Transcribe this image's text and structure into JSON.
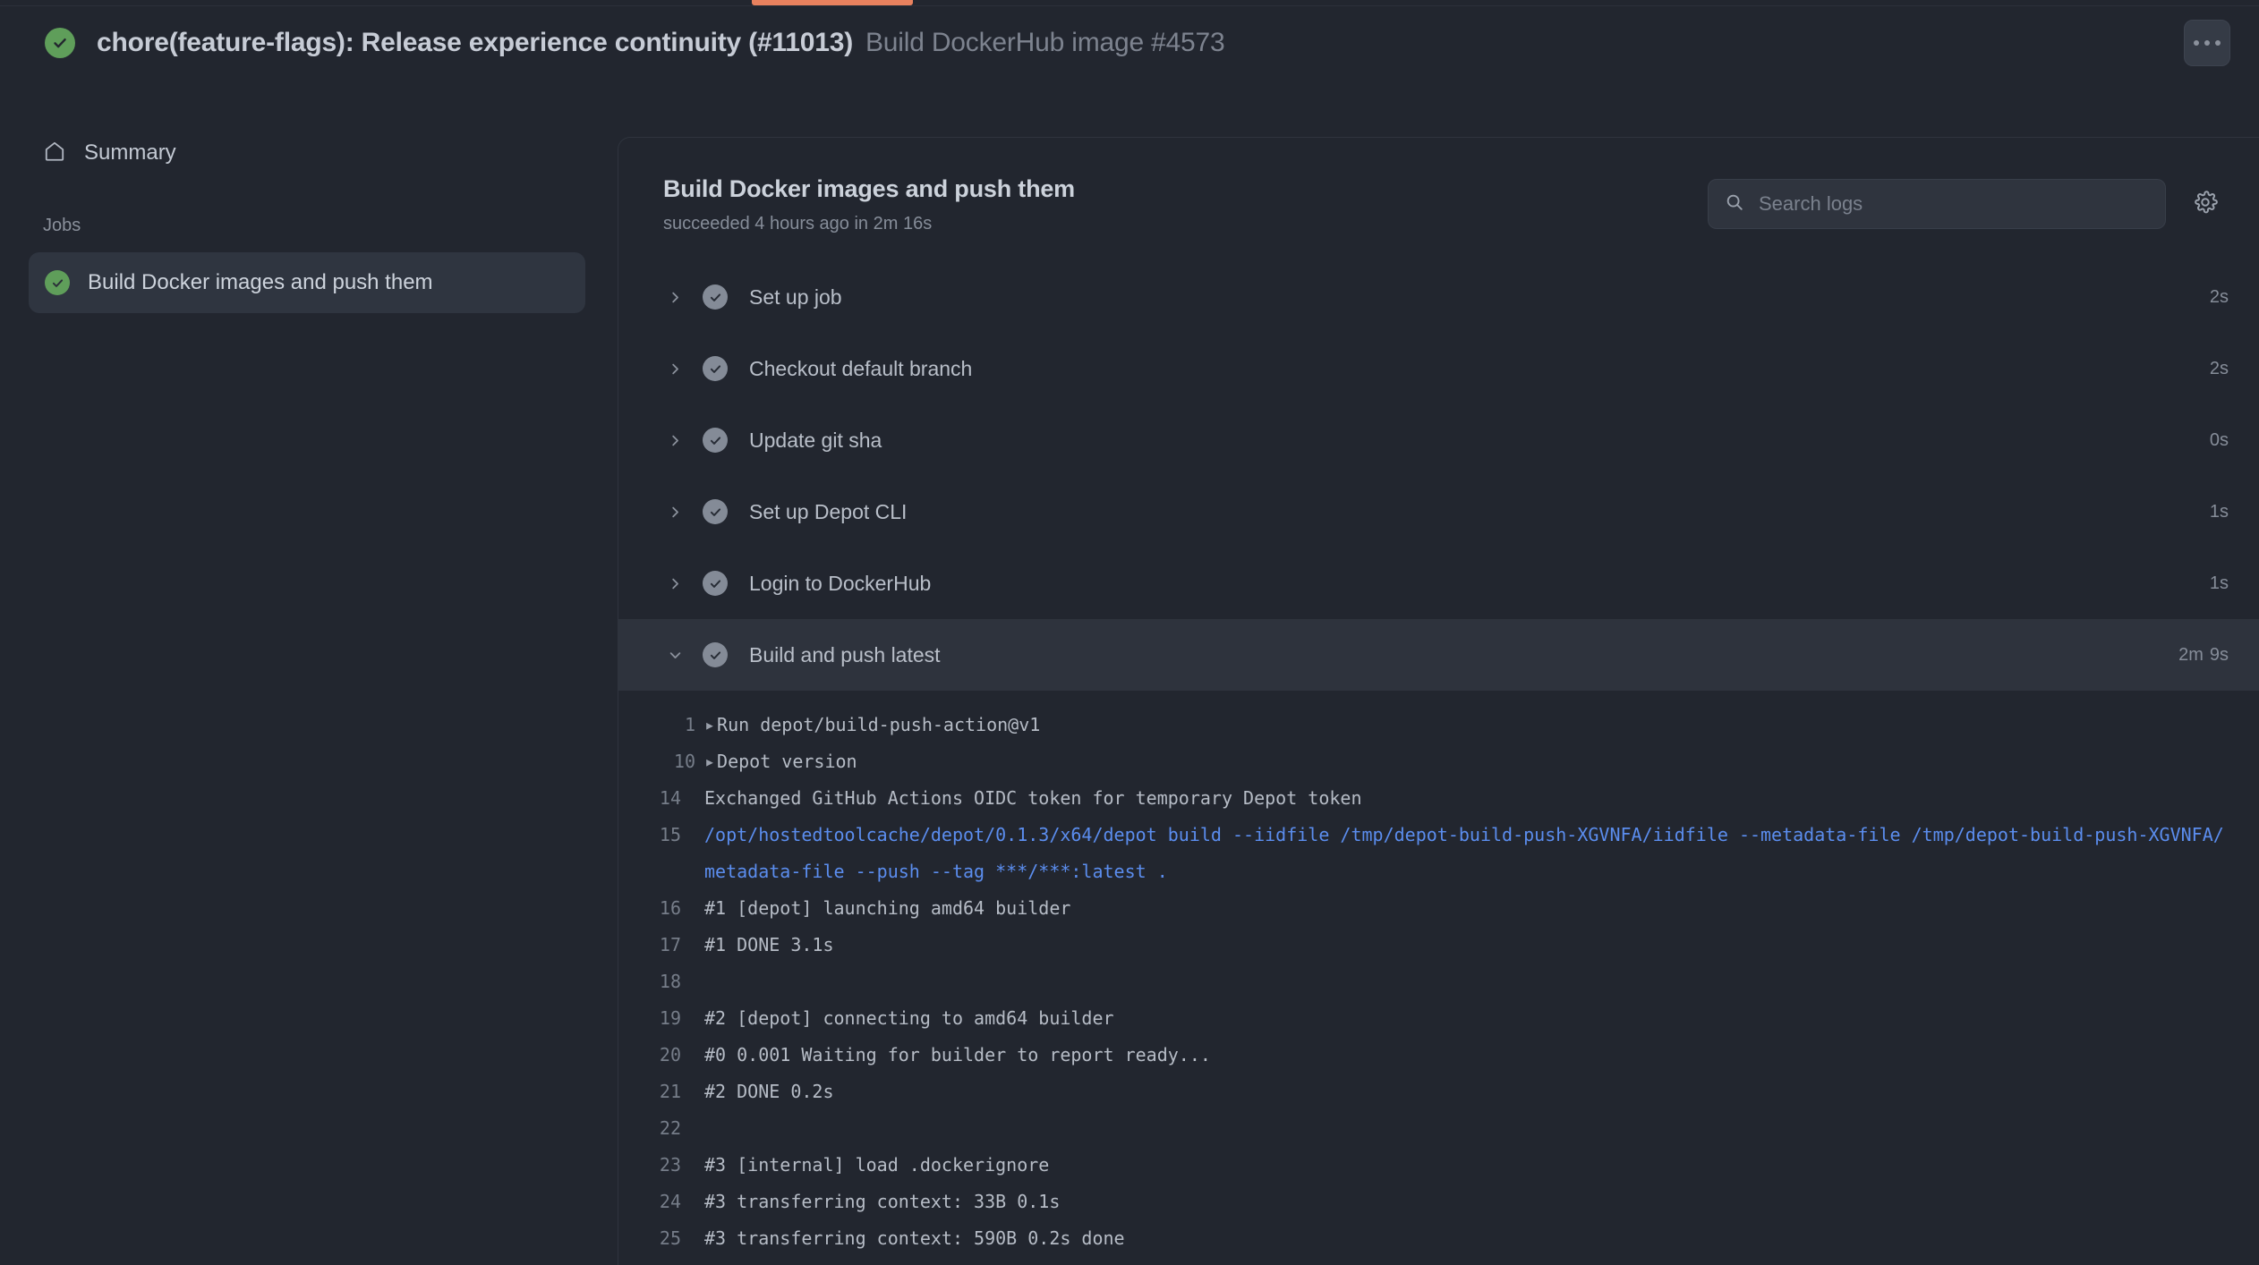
{
  "header": {
    "status_icon": "check-circle-icon",
    "run_title": "chore(feature-flags): Release experience continuity (#11013)",
    "workflow_subtitle": "Build DockerHub image #4573",
    "kebab_label": "More options",
    "accent_color": "#e8815e",
    "success_color": "#5f9e5a"
  },
  "sidebar": {
    "summary": {
      "icon": "home-icon",
      "label": "Summary"
    },
    "section_title": "Jobs",
    "jobs": [
      {
        "label": "Build Docker images and push them",
        "status": "success",
        "selected": true
      }
    ]
  },
  "panel": {
    "title": "Build Docker images and push them",
    "meta": "succeeded 4 hours ago in 2m 16s",
    "search": {
      "placeholder": "Search logs",
      "value": "",
      "icon": "search-icon"
    },
    "settings_icon": "gear-icon"
  },
  "steps": [
    {
      "name": "Set up job",
      "status": "success",
      "expanded": false,
      "duration": "2s",
      "duration_minutes": ""
    },
    {
      "name": "Checkout default branch",
      "status": "success",
      "expanded": false,
      "duration": "2s",
      "duration_minutes": ""
    },
    {
      "name": "Update git sha",
      "status": "success",
      "expanded": false,
      "duration": "0s",
      "duration_minutes": ""
    },
    {
      "name": "Set up Depot CLI",
      "status": "success",
      "expanded": false,
      "duration": "1s",
      "duration_minutes": ""
    },
    {
      "name": "Login to DockerHub",
      "status": "success",
      "expanded": false,
      "duration": "1s",
      "duration_minutes": ""
    },
    {
      "name": "Build and push latest",
      "status": "success",
      "expanded": true,
      "duration": "9s",
      "duration_minutes": "2m"
    }
  ],
  "log": {
    "lines": [
      {
        "num": "1",
        "text": "Run depot/build-push-action@v1",
        "collapsible": true,
        "kind": "plain"
      },
      {
        "num": "10",
        "text": "Depot version",
        "collapsible": true,
        "kind": "plain"
      },
      {
        "num": "14",
        "text": "Exchanged GitHub Actions OIDC token for temporary Depot token",
        "collapsible": false,
        "kind": "plain"
      },
      {
        "num": "15",
        "text": "/opt/hostedtoolcache/depot/0.1.3/x64/depot build --iidfile /tmp/depot-build-push-XGVNFA/iidfile --metadata-file /tmp/depot-build-push-XGVNFA/metadata-file --push --tag ***/***:latest .",
        "collapsible": false,
        "kind": "command"
      },
      {
        "num": "16",
        "text": "#1 [depot] launching amd64 builder",
        "collapsible": false,
        "kind": "plain"
      },
      {
        "num": "17",
        "text": "#1 DONE 3.1s",
        "collapsible": false,
        "kind": "plain"
      },
      {
        "num": "18",
        "text": "",
        "collapsible": false,
        "kind": "plain"
      },
      {
        "num": "19",
        "text": "#2 [depot] connecting to amd64 builder",
        "collapsible": false,
        "kind": "plain"
      },
      {
        "num": "20",
        "text": "#0 0.001 Waiting for builder to report ready...",
        "collapsible": false,
        "kind": "plain"
      },
      {
        "num": "21",
        "text": "#2 DONE 0.2s",
        "collapsible": false,
        "kind": "plain"
      },
      {
        "num": "22",
        "text": "",
        "collapsible": false,
        "kind": "plain"
      },
      {
        "num": "23",
        "text": "#3 [internal] load .dockerignore",
        "collapsible": false,
        "kind": "plain"
      },
      {
        "num": "24",
        "text": "#3 transferring context: 33B 0.1s",
        "collapsible": false,
        "kind": "plain"
      },
      {
        "num": "25",
        "text": "#3 transferring context: 590B 0.2s done",
        "collapsible": false,
        "kind": "plain"
      }
    ]
  }
}
